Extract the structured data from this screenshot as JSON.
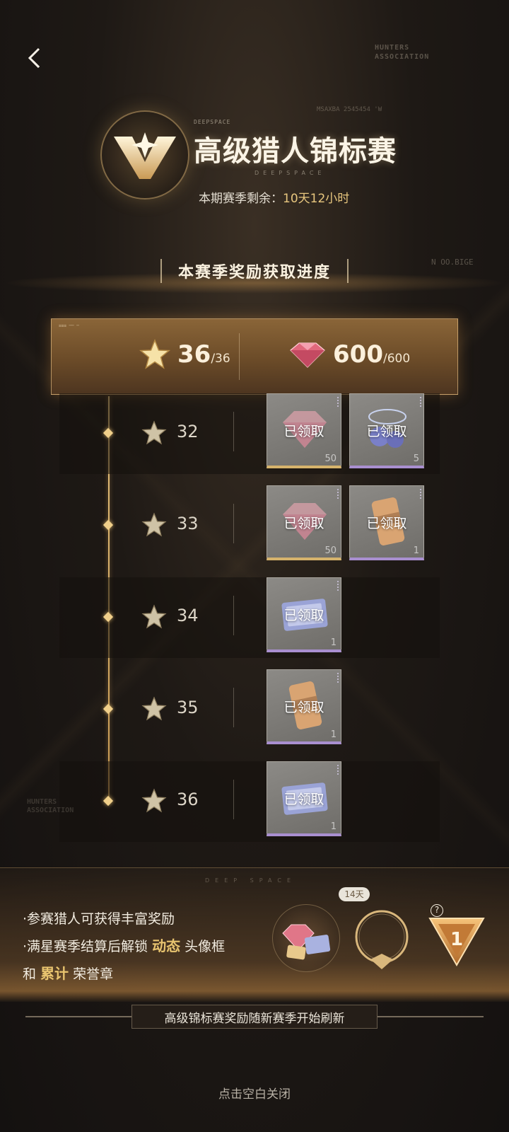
{
  "header": {
    "hunters_tag": [
      "HUNTERS",
      "ASSOCIATION"
    ],
    "title_small": "DEEPSPACE",
    "title": "高级猎人锦标赛",
    "title_watermark": "DEEPSPACE",
    "season_label": "本期赛季剩余：",
    "season_time": "10天12小时"
  },
  "section_title": "本赛季奖励获取进度",
  "summary": {
    "stars_current": "36",
    "stars_total": "/36",
    "gems_current": "600",
    "gems_total": "/600"
  },
  "tiers": [
    {
      "stars": "32",
      "rewards": [
        {
          "status": "已领取",
          "qty": "50",
          "icon": "gem-icon"
        },
        {
          "status": "已领取",
          "qty": "5",
          "icon": "blue-orb-icon"
        }
      ]
    },
    {
      "stars": "33",
      "rewards": [
        {
          "status": "已领取",
          "qty": "50",
          "icon": "gem-icon"
        },
        {
          "status": "已领取",
          "qty": "1",
          "icon": "drink-can-icon"
        }
      ]
    },
    {
      "stars": "34",
      "rewards": [
        {
          "status": "已领取",
          "qty": "1",
          "icon": "ticket-card-icon"
        }
      ]
    },
    {
      "stars": "35",
      "rewards": [
        {
          "status": "已领取",
          "qty": "1",
          "icon": "drink-can-icon"
        }
      ]
    },
    {
      "stars": "36",
      "rewards": [
        {
          "status": "已领取",
          "qty": "1",
          "icon": "ticket-card-icon"
        }
      ]
    }
  ],
  "bottom": {
    "deep_space": "DEEP SPACE",
    "note1": "·参赛猎人可获得丰富奖励",
    "note2_a": "·满星赛季结算后解锁",
    "note2_hl": "动态",
    "note2_b": "头像框",
    "note3_a": "和",
    "note3_hl": "累计",
    "note3_b": "荣誉章",
    "days_badge": "14天",
    "help": "?",
    "medal_number": "1",
    "refresh_text": "高级锦标赛奖励随新赛季开始刷新",
    "close_hint": "点击空白关闭"
  },
  "colors": {
    "accent_gold": "#e8c46f",
    "rarity_gold": "#d6b36c",
    "rarity_purple": "#a98fd0"
  }
}
